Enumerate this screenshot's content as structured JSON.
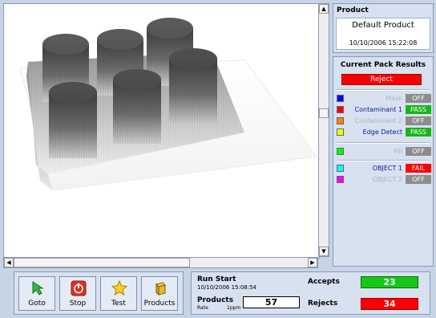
{
  "product": {
    "title": "Product",
    "name": "Default Product",
    "datetime": "10/10/2006 15:22:08"
  },
  "results": {
    "title": "Current Pack Results",
    "overall": "Reject",
    "inspections": [
      {
        "label": "Mask",
        "status": "OFF",
        "swatch": "#0000ff",
        "enabled": false,
        "status_color": "#8c8c8c"
      },
      {
        "label": "Contaminant 1",
        "status": "PASS",
        "swatch": "#ff0000",
        "enabled": true,
        "status_color": "#19b419"
      },
      {
        "label": "Contaminant 2",
        "status": "OFF",
        "swatch": "#ff8000",
        "enabled": false,
        "status_color": "#8c8c8c"
      },
      {
        "label": "Edge Detect",
        "status": "PASS",
        "swatch": "#ffff00",
        "enabled": true,
        "status_color": "#19b419"
      },
      {
        "label": "Fill",
        "status": "OFF",
        "swatch": "#00ff00",
        "enabled": false,
        "status_color": "#8c8c8c"
      },
      {
        "label": "OBJECT 1",
        "status": "FAIL",
        "swatch": "#00ffff",
        "enabled": true,
        "status_color": "#ff0000"
      },
      {
        "label": "OBJECT 2",
        "status": "OFF",
        "swatch": "#ff00ff",
        "enabled": false,
        "status_color": "#8c8c8c"
      }
    ]
  },
  "toolbar": {
    "goto": "Goto",
    "stop": "Stop",
    "test": "Test",
    "products": "Products"
  },
  "stats": {
    "run_start_label": "Run Start",
    "run_start_value": "10/10/2006 15:08:54",
    "products_label": "Products",
    "rate_label": "Rate",
    "rate_unit": "1ppm",
    "products_value": "57",
    "accepts_label": "Accepts",
    "accepts_value": "23",
    "rejects_label": "Rejects",
    "rejects_value": "34"
  },
  "scroll": {
    "up_arrow": "▲",
    "down_arrow": "▼",
    "left_arrow": "◀",
    "right_arrow": "▶"
  }
}
